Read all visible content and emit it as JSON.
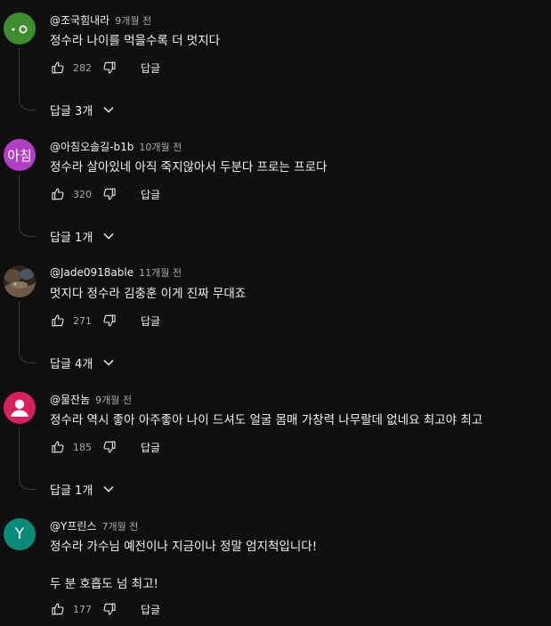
{
  "comments": [
    {
      "author": "@조국힘내라",
      "time": "9개월 전",
      "lines": [
        "정수라 나이를 먹을수록 더 멋지다"
      ],
      "likes": "282",
      "reply_label": "답글",
      "replies_label": "답글 3개",
      "avatar": {
        "type": "dots",
        "bg": "#3d8c2f"
      }
    },
    {
      "author": "@아침오솔길-b1b",
      "time": "10개월 전",
      "lines": [
        "정수라 살아있네 아직 죽지않아서 두분다 프로는 프로다"
      ],
      "likes": "320",
      "reply_label": "답글",
      "replies_label": "답글 1개",
      "avatar": {
        "type": "text",
        "text": "아침",
        "bg": "#b13fc6"
      }
    },
    {
      "author": "@Jade0918able",
      "time": "11개월 전",
      "lines": [
        "멋지다 정수라 김충훈 이게 진짜 무대죠"
      ],
      "likes": "271",
      "reply_label": "답글",
      "replies_label": "답글 4개",
      "avatar": {
        "type": "photo",
        "bg": "#3b3027"
      }
    },
    {
      "author": "@물잔놈",
      "time": "9개월 전",
      "lines": [
        "정수라 역시 좋아 아주좋아 나이 드셔도 얼굴 몸매 가창력 나무랄데 없네요 최고야 최고"
      ],
      "likes": "185",
      "reply_label": "답글",
      "replies_label": "답글 1개",
      "avatar": {
        "type": "person",
        "bg": "#d9205e"
      }
    },
    {
      "author": "@Y프린스",
      "time": "7개월 전",
      "lines": [
        "정수라 가수님 예전이나 지금이나 정말 엄지척입니다!",
        "",
        "두 분 호흡도 넘 최고!"
      ],
      "likes": "177",
      "reply_label": "답글",
      "replies_label": "",
      "avatar": {
        "type": "text",
        "text": "Y",
        "bg": "#0a8a78"
      }
    }
  ],
  "icons": {
    "like": "thumb-up-icon",
    "dislike": "thumb-down-icon",
    "chevron": "chevron-down-icon"
  }
}
